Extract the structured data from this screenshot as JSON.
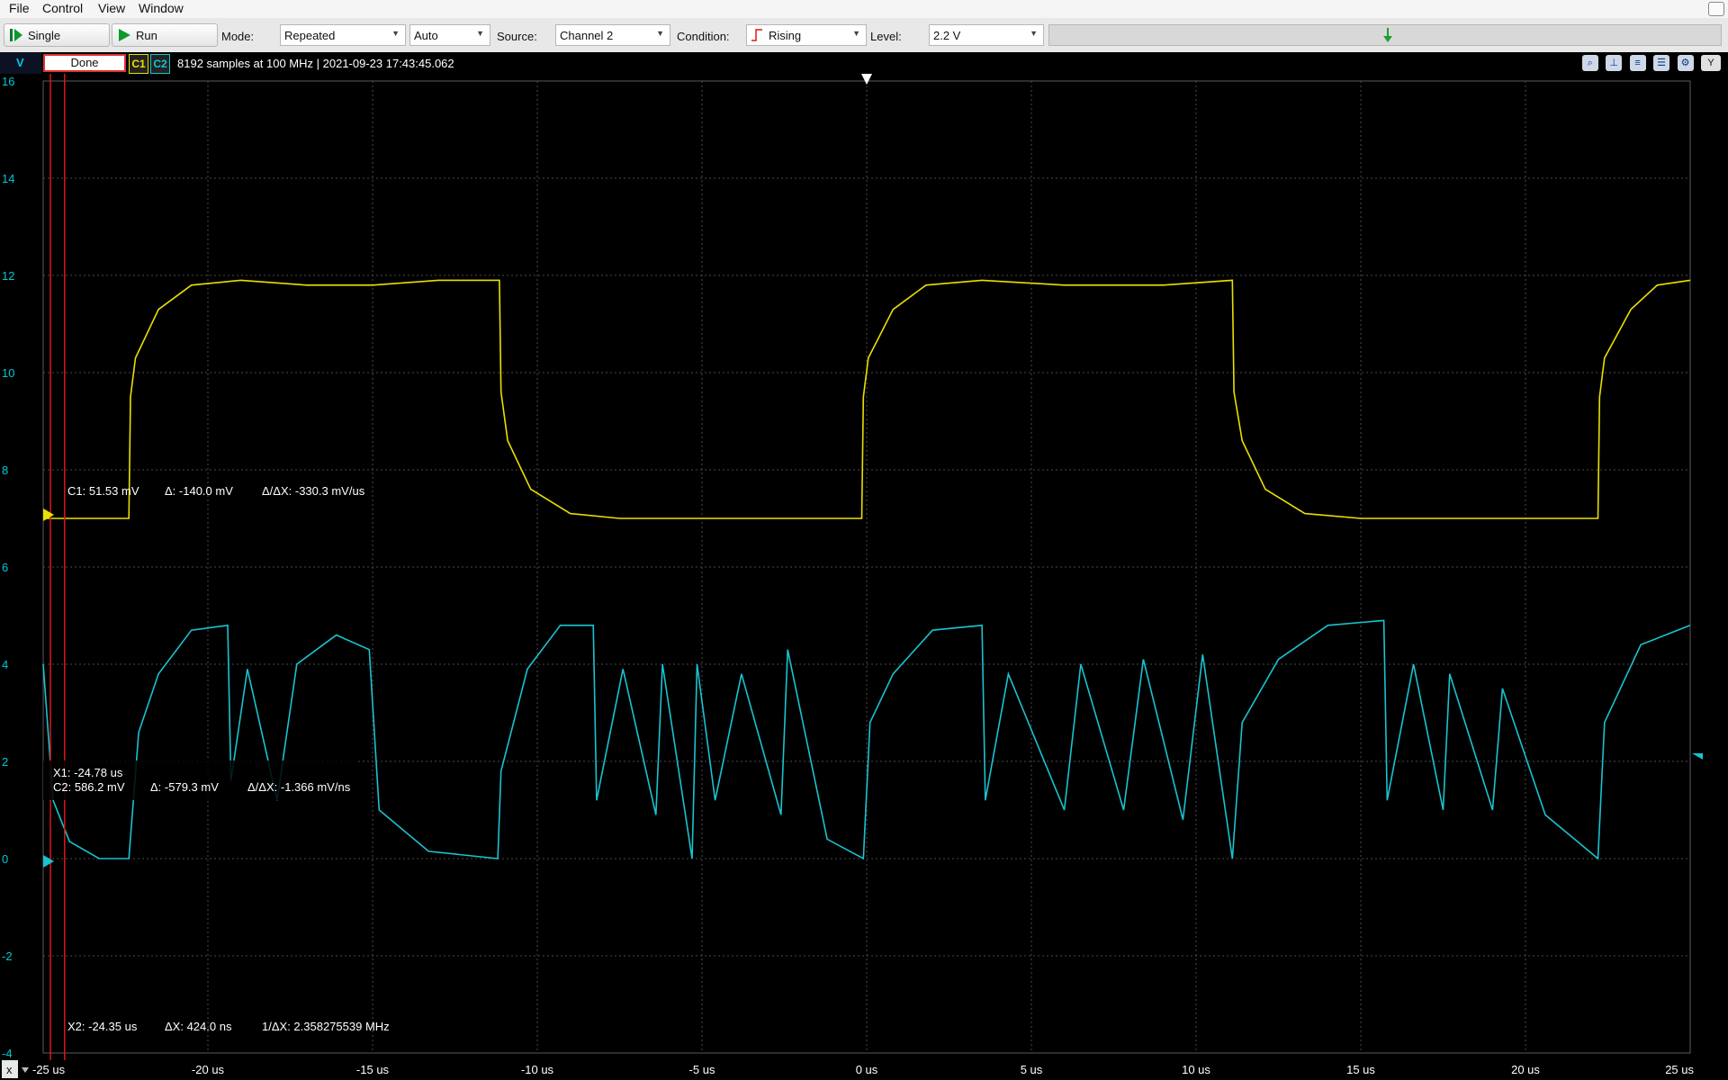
{
  "menu": [
    "File",
    "Control",
    "View",
    "Window"
  ],
  "toolbar": {
    "single_label": "Single",
    "run_label": "Run",
    "mode_label": "Mode:",
    "mode_value": "Repeated",
    "auto_value": "Auto",
    "source_label": "Source:",
    "source_value": "Channel 2",
    "condition_label": "Condition:",
    "condition_value": "Rising",
    "level_label": "Level:",
    "level_value": "2.2 V"
  },
  "status": {
    "axis_unit": "V",
    "state": "Done",
    "channel1_tag": "C1",
    "channel2_tag": "C2",
    "acquisition_text": "8192 samples at 100 MHz | 2021-09-23 17:43:45.062",
    "y_axis_button": "Y"
  },
  "colors": {
    "channel1": "#e8e000",
    "channel2": "#19c3d0",
    "cursor": "#d81818",
    "grid": "#4a4a4a",
    "background": "#000000"
  },
  "axes": {
    "y_ticks": [
      "16",
      "14",
      "12",
      "10",
      "8",
      "6",
      "4",
      "2",
      "0",
      "-2",
      "-4"
    ],
    "x_ticks": [
      "-25 us",
      "-20 us",
      "-15 us",
      "-10 us",
      "-5 us",
      "0 us",
      "5 us",
      "10 us",
      "15 us",
      "20 us",
      "25 us"
    ],
    "x_menu_button": "x"
  },
  "readouts": {
    "c1_value": "C1: 51.53 mV",
    "c1_delta": "Δ: -140.0 mV",
    "c1_slope": "Δ/ΔX: -330.3 mV/us",
    "x1_value": "X1: -24.78 us",
    "c2_value": "C2: 586.2 mV",
    "c2_delta": "Δ: -579.3 mV",
    "c2_slope": "Δ/ΔX: -1.366 mV/ns",
    "x2_value": "X2: -24.35 us",
    "dx_value": "ΔX: 424.0 ns",
    "freq_value": "1/ΔX: 2.358275539 MHz"
  },
  "chart_data": {
    "type": "line",
    "x_unit": "us",
    "y_unit": "V",
    "xlim": [
      -25,
      25
    ],
    "ylim": [
      -4,
      16
    ],
    "grid": true,
    "cursors": {
      "X1": -24.78,
      "X2": -24.35
    },
    "trigger": {
      "source": "Channel 2",
      "condition": "Rising",
      "level": 2.2,
      "time": 0
    },
    "series": [
      {
        "name": "C1",
        "x": [
          -25,
          -22.4,
          -22.35,
          -22.2,
          -21.5,
          -20.5,
          -19,
          -17,
          -15,
          -13,
          -11.15,
          -11.1,
          -10.9,
          -10.2,
          -9,
          -7.5,
          -5,
          -2,
          -0.15,
          -0.1,
          0.05,
          0.8,
          1.8,
          3.5,
          6,
          9,
          11.1,
          11.15,
          11.4,
          12.1,
          13.3,
          15,
          18,
          22.2,
          22.25,
          22.4,
          23.2,
          24,
          25
        ],
        "y": [
          7.0,
          7.0,
          9.5,
          10.3,
          11.3,
          11.8,
          11.9,
          11.8,
          11.8,
          11.9,
          11.9,
          9.6,
          8.6,
          7.6,
          7.1,
          7.0,
          7.0,
          7.0,
          7.0,
          9.5,
          10.3,
          11.3,
          11.8,
          11.9,
          11.8,
          11.8,
          11.9,
          9.6,
          8.6,
          7.6,
          7.1,
          7.0,
          7.0,
          7.0,
          9.5,
          10.3,
          11.3,
          11.8,
          11.9
        ]
      },
      {
        "name": "C2",
        "x": [
          -25,
          -24.7,
          -24.2,
          -23.3,
          -22.4,
          -22.1,
          -21.5,
          -20.5,
          -19.4,
          -19.3,
          -18.8,
          -17.9,
          -17.3,
          -16.1,
          -15.1,
          -14.8,
          -13.3,
          -11.2,
          -11.1,
          -10.3,
          -9.3,
          -8.3,
          -8.2,
          -7.4,
          -6.4,
          -6.2,
          -5.3,
          -5.15,
          -4.6,
          -3.8,
          -2.6,
          -2.4,
          -1.2,
          -0.1,
          0.1,
          0.8,
          2.0,
          3.5,
          3.6,
          4.3,
          6.0,
          6.5,
          7.8,
          8.4,
          9.6,
          10.2,
          11.1,
          11.4,
          12.5,
          14.0,
          15.7,
          15.8,
          16.6,
          17.5,
          17.7,
          19.0,
          19.3,
          20.6,
          22.2,
          22.4,
          23.5,
          25
        ],
        "y": [
          4.0,
          1.2,
          0.35,
          0.0,
          0.0,
          2.6,
          3.8,
          4.7,
          4.8,
          1.6,
          3.9,
          1.2,
          4.0,
          4.6,
          4.3,
          1.0,
          0.15,
          0.0,
          1.8,
          3.9,
          4.8,
          4.8,
          1.2,
          3.9,
          0.9,
          4.0,
          0.0,
          4.0,
          1.2,
          3.8,
          0.9,
          4.3,
          0.4,
          0.0,
          2.8,
          3.8,
          4.7,
          4.8,
          1.2,
          3.8,
          1.0,
          4.0,
          1.0,
          4.1,
          0.8,
          4.2,
          0.0,
          2.8,
          4.1,
          4.8,
          4.9,
          1.2,
          4.0,
          1.0,
          3.8,
          1.0,
          3.5,
          0.9,
          0.0,
          2.8,
          4.4,
          4.8
        ]
      }
    ]
  }
}
